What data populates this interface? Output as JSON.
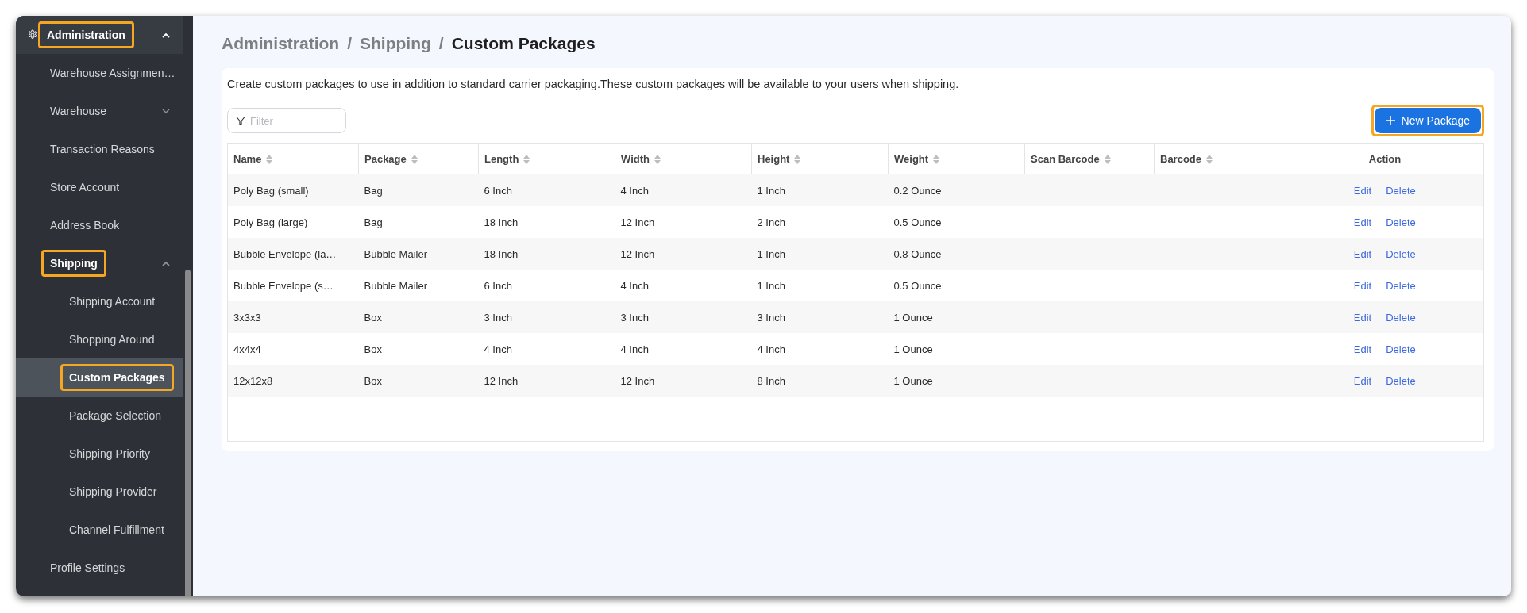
{
  "sidebar": {
    "items": [
      {
        "label": "Administration",
        "kind": "section",
        "expanded": true,
        "selected": false,
        "highlighted": true,
        "children": [
          {
            "label": "Warehouse Assignmen…",
            "selected": false,
            "highlighted": false
          },
          {
            "label": "Warehouse",
            "expanded": false,
            "selected": false,
            "highlighted": false
          },
          {
            "label": "Transaction Reasons",
            "selected": false,
            "highlighted": false
          },
          {
            "label": "Store Account",
            "selected": false,
            "highlighted": false
          },
          {
            "label": "Address Book",
            "selected": false,
            "highlighted": false
          },
          {
            "label": "Shipping",
            "expanded": true,
            "selected": false,
            "highlighted": true,
            "children": [
              {
                "label": "Shipping Account",
                "selected": false,
                "highlighted": false
              },
              {
                "label": "Shopping Around",
                "selected": false,
                "highlighted": false
              },
              {
                "label": "Custom Packages",
                "selected": true,
                "highlighted": true
              },
              {
                "label": "Package Selection",
                "selected": false,
                "highlighted": false
              },
              {
                "label": "Shipping Priority",
                "selected": false,
                "highlighted": false
              },
              {
                "label": "Shipping Provider",
                "selected": false,
                "highlighted": false
              },
              {
                "label": "Channel Fulfillment",
                "selected": false,
                "highlighted": false
              }
            ]
          }
        ]
      },
      {
        "label": "Profile Settings",
        "selected": false,
        "highlighted": false
      }
    ]
  },
  "breadcrumb": {
    "separator": "/",
    "items": [
      "Administration",
      "Shipping",
      "Custom Packages"
    ]
  },
  "description": "Create custom packages to use in addition to standard carrier packaging.These custom packages will be available to your users when shipping.",
  "filter": {
    "placeholder": "Filter"
  },
  "new_button": {
    "label": "New Package",
    "highlighted": true
  },
  "table": {
    "columns": [
      {
        "label": "Name",
        "sortable": true
      },
      {
        "label": "Package",
        "sortable": true
      },
      {
        "label": "Length",
        "sortable": true
      },
      {
        "label": "Width",
        "sortable": true
      },
      {
        "label": "Height",
        "sortable": true
      },
      {
        "label": "Weight",
        "sortable": true
      },
      {
        "label": "Scan Barcode",
        "sortable": true
      },
      {
        "label": "Barcode",
        "sortable": true
      },
      {
        "label": "Action",
        "sortable": false
      }
    ],
    "rows": [
      {
        "cells": [
          "Poly Bag (small)",
          "Bag",
          "6 Inch",
          "4 Inch",
          "1 Inch",
          "0.2 Ounce",
          "",
          ""
        ],
        "actions": [
          "Edit",
          "Delete"
        ]
      },
      {
        "cells": [
          "Poly Bag (large)",
          "Bag",
          "18 Inch",
          "12 Inch",
          "2 Inch",
          "0.5 Ounce",
          "",
          ""
        ],
        "actions": [
          "Edit",
          "Delete"
        ]
      },
      {
        "cells": [
          "Bubble Envelope (la…",
          "Bubble Mailer",
          "18 Inch",
          "12 Inch",
          "1 Inch",
          "0.8 Ounce",
          "",
          ""
        ],
        "actions": [
          "Edit",
          "Delete"
        ]
      },
      {
        "cells": [
          "Bubble Envelope (s…",
          "Bubble Mailer",
          "6 Inch",
          "4 Inch",
          "1 Inch",
          "0.5 Ounce",
          "",
          ""
        ],
        "actions": [
          "Edit",
          "Delete"
        ]
      },
      {
        "cells": [
          "3x3x3",
          "Box",
          "3 Inch",
          "3 Inch",
          "3 Inch",
          "1 Ounce",
          "",
          ""
        ],
        "actions": [
          "Edit",
          "Delete"
        ]
      },
      {
        "cells": [
          "4x4x4",
          "Box",
          "4 Inch",
          "4 Inch",
          "4 Inch",
          "1 Ounce",
          "",
          ""
        ],
        "actions": [
          "Edit",
          "Delete"
        ]
      },
      {
        "cells": [
          "12x12x8",
          "Box",
          "12 Inch",
          "12 Inch",
          "8 Inch",
          "1 Ounce",
          "",
          ""
        ],
        "actions": [
          "Edit",
          "Delete"
        ]
      }
    ]
  }
}
